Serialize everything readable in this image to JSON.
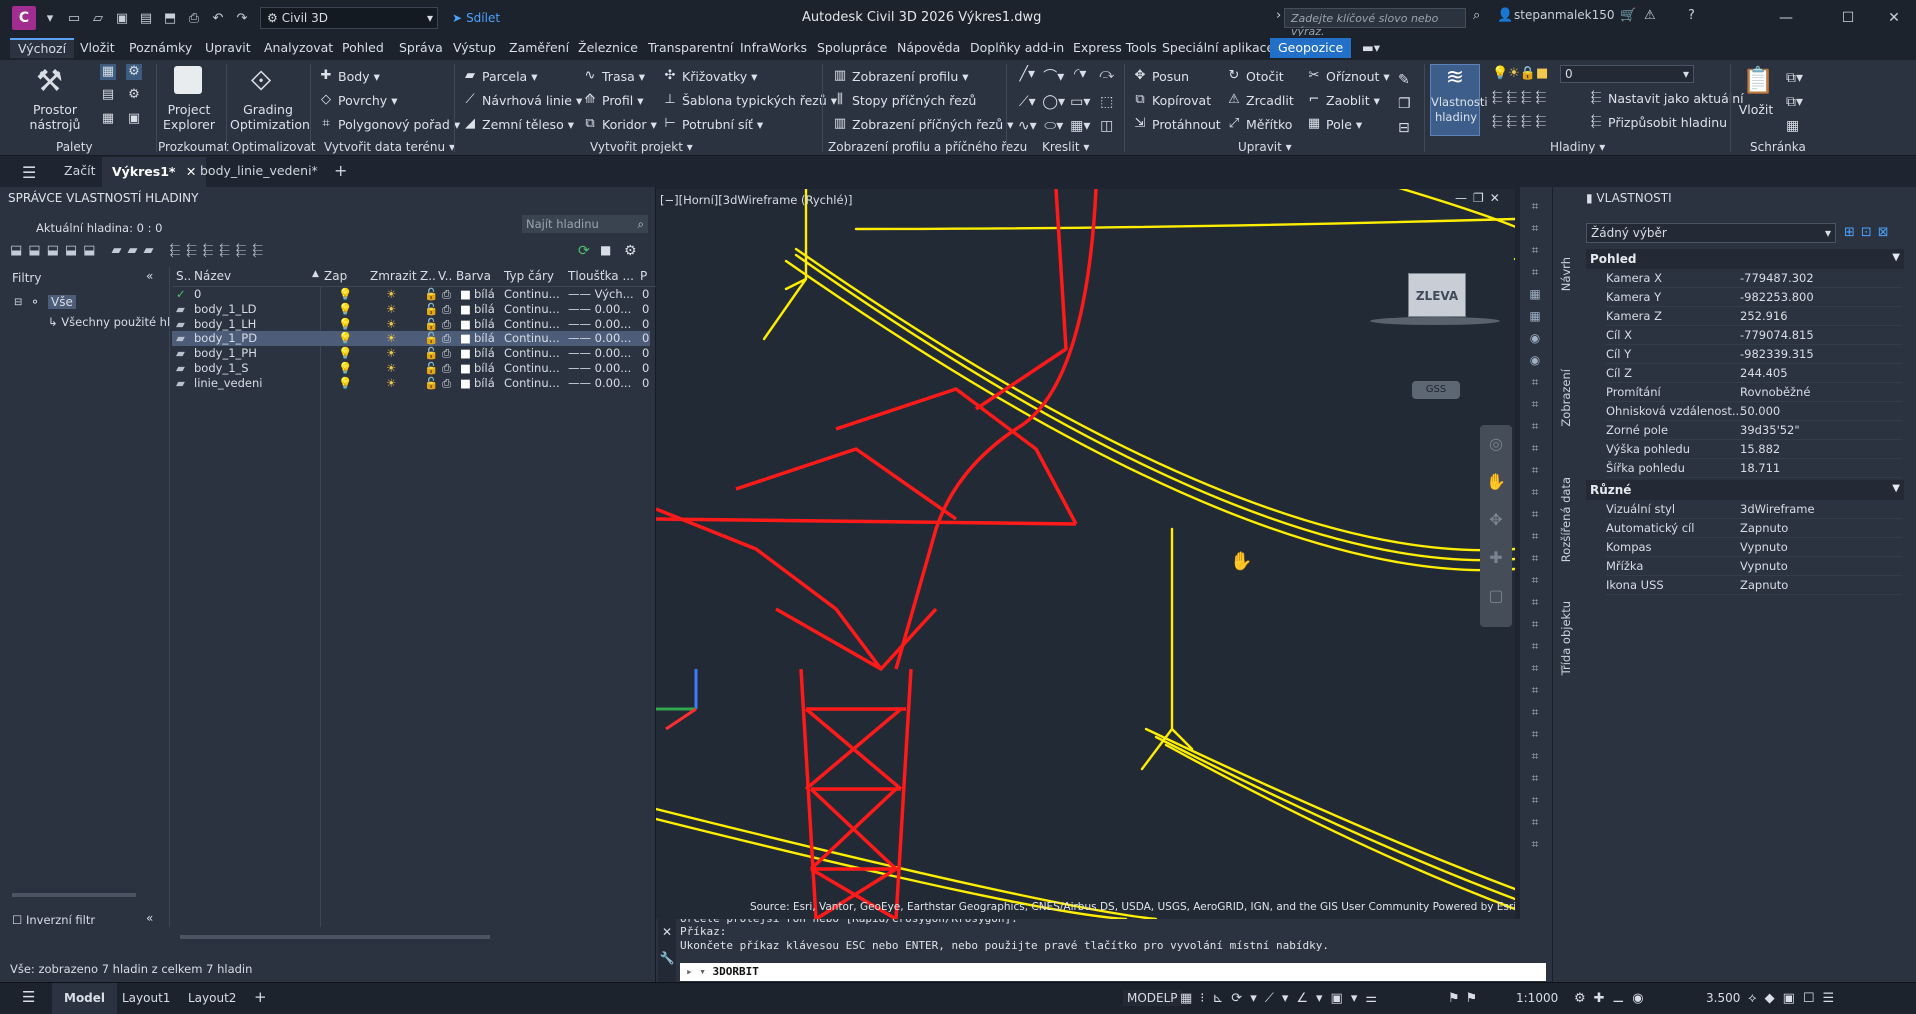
{
  "titlebar": {
    "app_initial": "C",
    "workspace": "Civil 3D",
    "share": "Sdílet",
    "title": "Autodesk Civil 3D 2026    Výkres1.dwg",
    "search_placeholder": "Zadejte klíčové slovo nebo výraz.",
    "user": "stepanmalek150"
  },
  "menu_tabs": [
    "Výchozí",
    "Vložit",
    "Poznámky",
    "Upravit",
    "Analyzovat",
    "Pohled",
    "Správa",
    "Výstup",
    "Zaměření",
    "Železnice",
    "Transparentní",
    "InfraWorks",
    "Spolupráce",
    "Nápověda",
    "Doplňky add-in",
    "Express Tools",
    "Speciální aplikace",
    "Geopozice"
  ],
  "ribbon": {
    "prostor": "Prostor nástrojů",
    "project_explorer_1": "Project",
    "project_explorer_2": "Explorer",
    "grading_1": "Grading",
    "grading_2": "Optimization",
    "body": "Body",
    "povrchy": "Povrchy",
    "polygon": "Polygonový pořad",
    "parcela": "Parcela",
    "navrhova": "Návrhová linie",
    "zemni": "Zemní těleso",
    "trasa": "Trasa",
    "profil": "Profil",
    "koridor": "Koridor",
    "krizovatky": "Křižovatky",
    "sablona": "Šablona typických řezů",
    "potrubni": "Potrubní síť",
    "zobrazeni_profilu": "Zobrazení profilu",
    "stopy": "Stopy příčných řezů",
    "zobrazeni_rezu": "Zobrazení příčných řezů",
    "posun": "Posun",
    "otocit": "Otočit",
    "oriznout": "Oříznout",
    "kopirovat": "Kopírovat",
    "zrcadlit": "Zrcadlit",
    "zaoblit": "Zaoblit",
    "protahnout": "Protáhnout",
    "meritko": "Měřítko",
    "pole": "Pole",
    "vlastnosti_1": "Vlastnosti",
    "vlastnosti_2": "hladiny",
    "layer_value": "0",
    "nastavit": "Nastavit jako aktuální",
    "prizpusobit": "Přizpůsobit hladinu",
    "vlozit": "Vložit",
    "panels": {
      "palety": "Palety",
      "prozkoumat": "Prozkoumat",
      "optimalizovat": "Optimalizovat",
      "vytvorit_data": "Vytvořit data terénu",
      "vytvorit_projekt": "Vytvořit projekt",
      "zobrazeni": "Zobrazení profilu a příčného řezu",
      "kreslit": "Kreslit",
      "upravit": "Upravit",
      "hladiny": "Hladiny",
      "schranka": "Schránka"
    }
  },
  "doc_tabs": {
    "start": "Začít",
    "drawing": "Výkres1*",
    "second": "body_linie_vedeni*"
  },
  "layer_manager": {
    "title": "SPRÁVCE VLASTNOSTÍ HLADINY",
    "current": "Aktuální hladina: 0 : 0",
    "search": "Najít hladinu",
    "filters": "Filtry",
    "tree_root": "Vše",
    "tree_child": "Všechny použité hl",
    "inverse": "Inverzní filtr",
    "footer": "Vše: zobrazeno 7 hladin z celkem 7 hladin",
    "columns": [
      "S..",
      "Název",
      "Zap",
      "Zmrazit",
      "Z..",
      "V..",
      "Barva",
      "Typ čáry",
      "Tloušťka ...",
      "P"
    ],
    "rows": [
      {
        "status": "✓",
        "name": "0",
        "color": "bílá",
        "linetype": "Continu...",
        "weight": "Vých...",
        "p": "0"
      },
      {
        "status": "",
        "name": "body_1_LD",
        "color": "bílá",
        "linetype": "Continu...",
        "weight": "0.00...",
        "p": "0"
      },
      {
        "status": "",
        "name": "body_1_LH",
        "color": "bílá",
        "linetype": "Continu...",
        "weight": "0.00...",
        "p": "0"
      },
      {
        "status": "",
        "name": "body_1_PD",
        "color": "bílá",
        "linetype": "Continu...",
        "weight": "0.00...",
        "p": "0"
      },
      {
        "status": "",
        "name": "body_1_PH",
        "color": "bílá",
        "linetype": "Continu...",
        "weight": "0.00...",
        "p": "0"
      },
      {
        "status": "",
        "name": "body_1_S",
        "color": "bílá",
        "linetype": "Continu...",
        "weight": "0.00...",
        "p": "0"
      },
      {
        "status": "",
        "name": "linie_vedeni",
        "color": "bílá",
        "linetype": "Continu...",
        "weight": "0.00...",
        "p": "0"
      }
    ]
  },
  "viewport": {
    "label": "[−][Horní][3dWireframe (Rychlé)]",
    "viewcube": "ZLEVA",
    "wcs": "GSS",
    "source": "Source: Esri, Vantor, GeoEye, Earthstar Geographics, CNES/Airbus DS, USDA, USGS, AeroGRID, IGN, and the GIS User Community Powered by Esri"
  },
  "command": {
    "line1": "Určete protější roh nebo [Rapid/Crosygon/Krosygon]:",
    "line2": "Příkaz:",
    "line3": "Ukončete příkaz klávesou ESC nebo ENTER, nebo použijte pravé tlačítko pro vyvolání místní nabídky.",
    "input": "3DORBIT"
  },
  "properties": {
    "title": "VLASTNOSTI",
    "selection": "Žádný výběr",
    "section1": "Pohled",
    "section2": "Různé",
    "pohled": [
      [
        "Kamera X",
        "-779487.302"
      ],
      [
        "Kamera Y",
        "-982253.800"
      ],
      [
        "Kamera Z",
        "252.916"
      ],
      [
        "Cíl X",
        "-779074.815"
      ],
      [
        "Cíl Y",
        "-982339.315"
      ],
      [
        "Cíl Z",
        "244.405"
      ],
      [
        "Promítání",
        "Rovnoběžné"
      ],
      [
        "Ohnisková  vzdálenost...",
        "50.000"
      ],
      [
        "Zorné pole",
        "39d35'52\""
      ],
      [
        "Výška pohledu",
        "15.882"
      ],
      [
        "Šířka pohledu",
        "18.711"
      ]
    ],
    "ruzne": [
      [
        "Vizuální styl",
        "3dWireframe"
      ],
      [
        "Automatický cíl",
        "Zapnuto"
      ],
      [
        "Kompas",
        "Vypnuto"
      ],
      [
        "Mřížka",
        "Vypnuto"
      ],
      [
        "Ikona USS",
        "Zapnuto"
      ]
    ],
    "side_tabs": [
      "Návrh",
      "Zobrazení",
      "Rozšířená data",
      "Třída objektu"
    ]
  },
  "statusbar": {
    "model": "Model",
    "layout1": "Layout1",
    "layout2": "Layout2",
    "modelp": "MODELP",
    "scale": "1:1000",
    "value": "3.500"
  },
  "colors": {
    "tower": "#ff1a1a",
    "wire": "#ffee00",
    "accent": "#2370c9"
  }
}
